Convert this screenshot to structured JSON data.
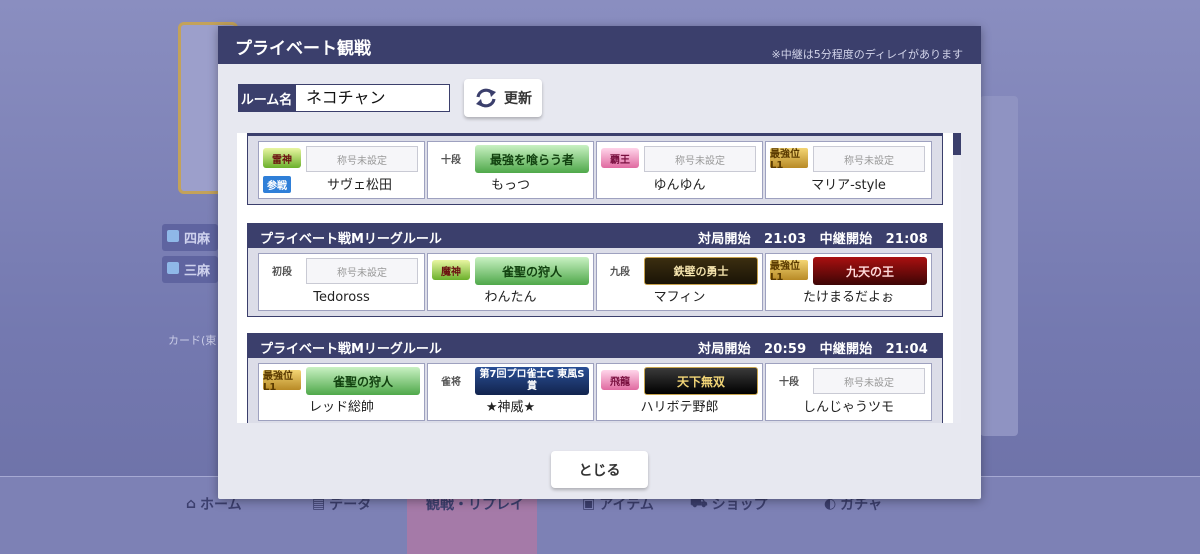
{
  "background": {
    "pills": [
      "四麻",
      "三麻"
    ],
    "card_label": "カード(東",
    "nav": {
      "home": "ホーム",
      "data": "データ",
      "watch": "観戦・リプレイ",
      "item": "アイテム",
      "shop": "ショップ",
      "gacha": "ガチャ"
    }
  },
  "modal": {
    "title": "プライベート観戦",
    "note": "※中継は5分程度のディレイがあります",
    "room_label": "ルーム名",
    "room_value": "ネコチャン",
    "refresh_label": "更新",
    "close_label": "とじる"
  },
  "matches": [
    {
      "rule": "",
      "time": "",
      "players": [
        {
          "rank": "雷神",
          "rank_style": "green",
          "title": "称号未設定",
          "title_style": "none",
          "name": "サヴェ松田",
          "badge": "参戦"
        },
        {
          "rank": "十段",
          "rank_style": "plain",
          "title": "最強を喰らう者",
          "title_style": "green",
          "name": "もっつ",
          "badge": ""
        },
        {
          "rank": "覇王",
          "rank_style": "pink",
          "title": "称号未設定",
          "title_style": "none",
          "name": "ゆんゆん",
          "badge": ""
        },
        {
          "rank": "最強位 L1",
          "rank_style": "gold",
          "title": "称号未設定",
          "title_style": "none",
          "name": "マリア-style",
          "badge": ""
        }
      ]
    },
    {
      "rule": "プライベート戦Mリーグルール",
      "time": "対局開始　21:03　中継開始　21:08",
      "players": [
        {
          "rank": "初段",
          "rank_style": "plain",
          "title": "称号未設定",
          "title_style": "none",
          "name": "Tedoross",
          "badge": ""
        },
        {
          "rank": "魔神",
          "rank_style": "green",
          "title": "雀聖の狩人",
          "title_style": "green",
          "name": "わんたん",
          "badge": ""
        },
        {
          "rank": "九段",
          "rank_style": "plain",
          "title": "鉄壁の勇士",
          "title_style": "gold",
          "name": "マフィン",
          "badge": ""
        },
        {
          "rank": "最強位 L1",
          "rank_style": "gold",
          "title": "九天の王",
          "title_style": "red",
          "name": "たけまるだよぉ",
          "badge": ""
        }
      ]
    },
    {
      "rule": "プライベート戦Mリーグルール",
      "time": "対局開始　20:59　中継開始　21:04",
      "players": [
        {
          "rank": "最強位 L1",
          "rank_style": "gold",
          "title": "雀聖の狩人",
          "title_style": "green",
          "name": "レッド総帥",
          "badge": ""
        },
        {
          "rank": "雀将",
          "rank_style": "plain",
          "title": "第7回プロ雀士C 東風S賞",
          "title_style": "blue",
          "name": "★神威★",
          "badge": ""
        },
        {
          "rank": "飛龍",
          "rank_style": "pink",
          "title": "天下無双",
          "title_style": "black",
          "name": "ハリボテ野郎",
          "badge": ""
        },
        {
          "rank": "十段",
          "rank_style": "plain",
          "title": "称号未設定",
          "title_style": "none",
          "name": "しんじゃうツモ",
          "badge": ""
        }
      ]
    }
  ]
}
